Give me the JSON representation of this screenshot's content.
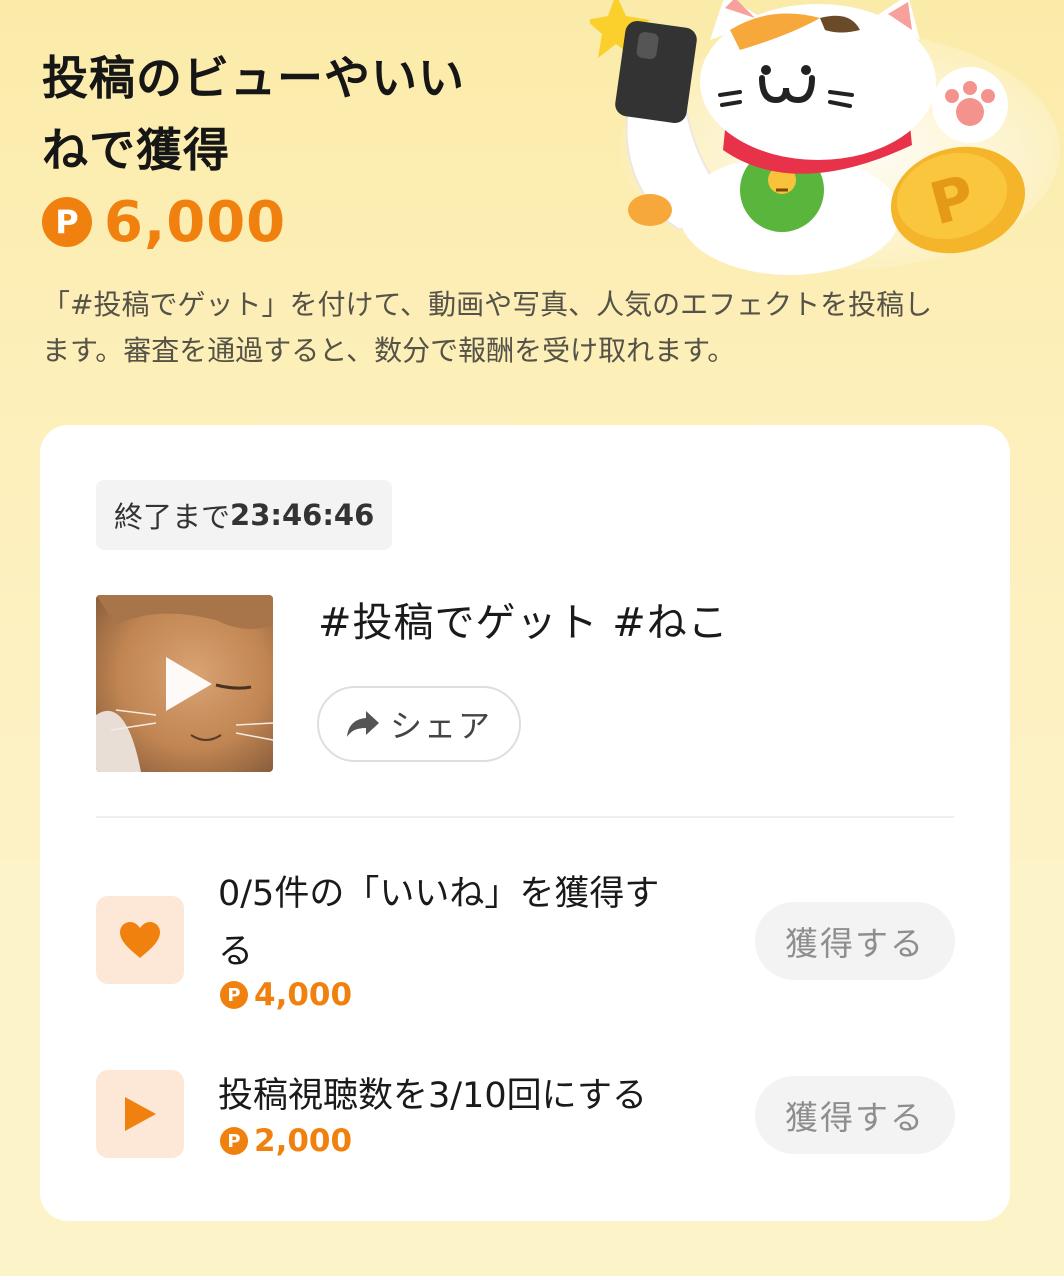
{
  "header": {
    "title_line1": "投稿のビューやいい",
    "title_line2": "ねで獲得",
    "total_reward": "6,000",
    "point_symbol": "P",
    "description_line1": "「#投稿でゲット」を付けて、動画や写真、人気のエフェクトを投稿し",
    "description_line2": "ます。審査を通過すると、数分で報酬を受け取れます。"
  },
  "card": {
    "timer_label": "終了まで",
    "timer_value": "23:46:46",
    "post_title": "#投稿でゲット #ねこ",
    "share_label": "シェア",
    "tasks": [
      {
        "text_line1": "0/5件の「いいね」を獲得す",
        "text_line2": "る",
        "reward": "4,000",
        "button_label": "獲得する",
        "icon": "heart-icon"
      },
      {
        "text_line1": "投稿視聴数を3/10回にする",
        "reward": "2,000",
        "button_label": "獲得する",
        "icon": "play-icon"
      }
    ]
  },
  "colors": {
    "accent": "#f0810f",
    "background": "#fdf1c2",
    "task_icon_bg": "#fde8d8",
    "button_bg": "#f3f3f3"
  }
}
